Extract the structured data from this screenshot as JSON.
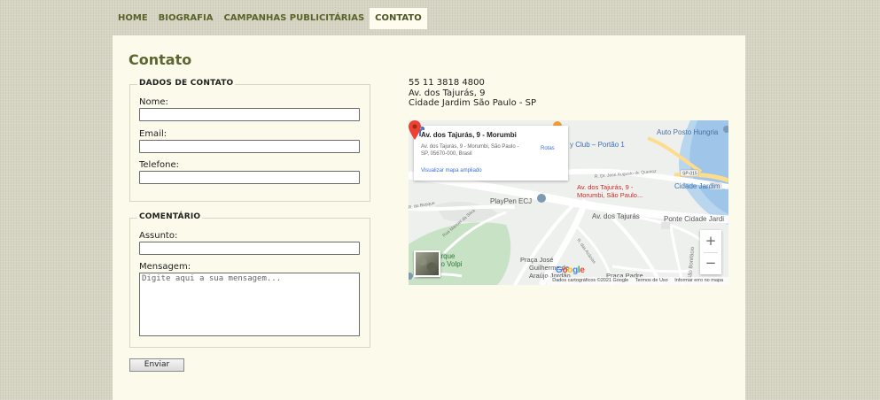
{
  "nav": {
    "items": [
      {
        "label": "HOME"
      },
      {
        "label": "BIOGRAFIA"
      },
      {
        "label": "CAMPANHAS PUBLICITÁRIAS"
      },
      {
        "label": "CONTATO"
      }
    ]
  },
  "page": {
    "title": "Contato"
  },
  "contact_data": {
    "legend": "DADOS DE CONTATO",
    "name_label": "Nome:",
    "email_label": "Email:",
    "phone_label": "Telefone:",
    "name_value": "",
    "email_value": "",
    "phone_value": ""
  },
  "comment": {
    "legend": "COMENTÁRIO",
    "subject_label": "Assunto:",
    "subject_value": "",
    "message_label": "Mensagem:",
    "message_placeholder": "Digite aqui a sua mensagem..."
  },
  "submit": {
    "label": "Enviar"
  },
  "address": {
    "phone": "55 11 3818 4800",
    "street": "Av. dos Tajurás, 9",
    "city": "Cidade Jardim São Paulo - SP"
  },
  "map": {
    "info_title": "Av. dos Tajurás, 9 - Morumbi",
    "info_address": "Av. dos Tajurás, 9 - Morumbi, São Paulo - SP, 05670-000, Brasil",
    "routes_label": "Rotas",
    "larger_map_link": "Visualizar mapa ampliado",
    "pin_label_line1": "Av. dos Tajurás, 9 -",
    "pin_label_line2": "Morumbi, São Paulo...",
    "zoom_in": "+",
    "zoom_out": "−",
    "google_letters": [
      "G",
      "o",
      "o",
      "g",
      "l",
      "e"
    ],
    "attribution": "Dados cartográficos ©2021 Google",
    "terms": "Termos de Uso",
    "report": "Informar erro no mapa",
    "labels": {
      "club": "y Club – Portão 1",
      "posto": "Auto Posto Hungria",
      "rua_jose": "R. Dr. José Augusto de Queiroz",
      "sp015": "SP-015",
      "cidade_jardim": "Cidade Jardim",
      "playpen": "PlayPen ECJ",
      "bosque": "R. do Bosque",
      "rua_manoel": "Rua Manoel da Silva",
      "av_tajuras": "Av. dos Tajurás",
      "ponte": "Ponte Cidade Jardi",
      "sao_bonifacio": "São Bonifácio",
      "praca_jose_1": "Praça José",
      "praca_jose_2": "Guilherme de",
      "praca_jose_3": "Araújo Jordão",
      "praca_padre": "Praça Padre",
      "parque_1": "arque",
      "parque_2": "do Volpi",
      "acacias": "R. das Acácias"
    },
    "colors": {
      "road": "#ffffff",
      "land": "#eef0ee",
      "water": "#9fc5e8",
      "park": "#c7e2c4",
      "highway": "#fddc8c",
      "pin": "#ea4335"
    }
  },
  "colors": {
    "nav_text": "#5a6328",
    "title": "#5c6630",
    "page_bg": "#fbfaeb",
    "body_bg": "#d6d5c3"
  }
}
